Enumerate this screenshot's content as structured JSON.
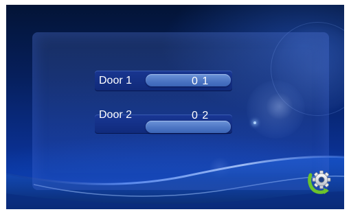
{
  "doors": [
    {
      "label": "Door 1",
      "code": "0 1"
    },
    {
      "label": "Door 2",
      "code": "0 2"
    }
  ],
  "settings": {
    "icon": "gear-icon",
    "accent_color": "#6bc32c"
  },
  "colors": {
    "background": "#0a2f8e",
    "row": "#163a8f",
    "pill": "#5a82cc"
  }
}
